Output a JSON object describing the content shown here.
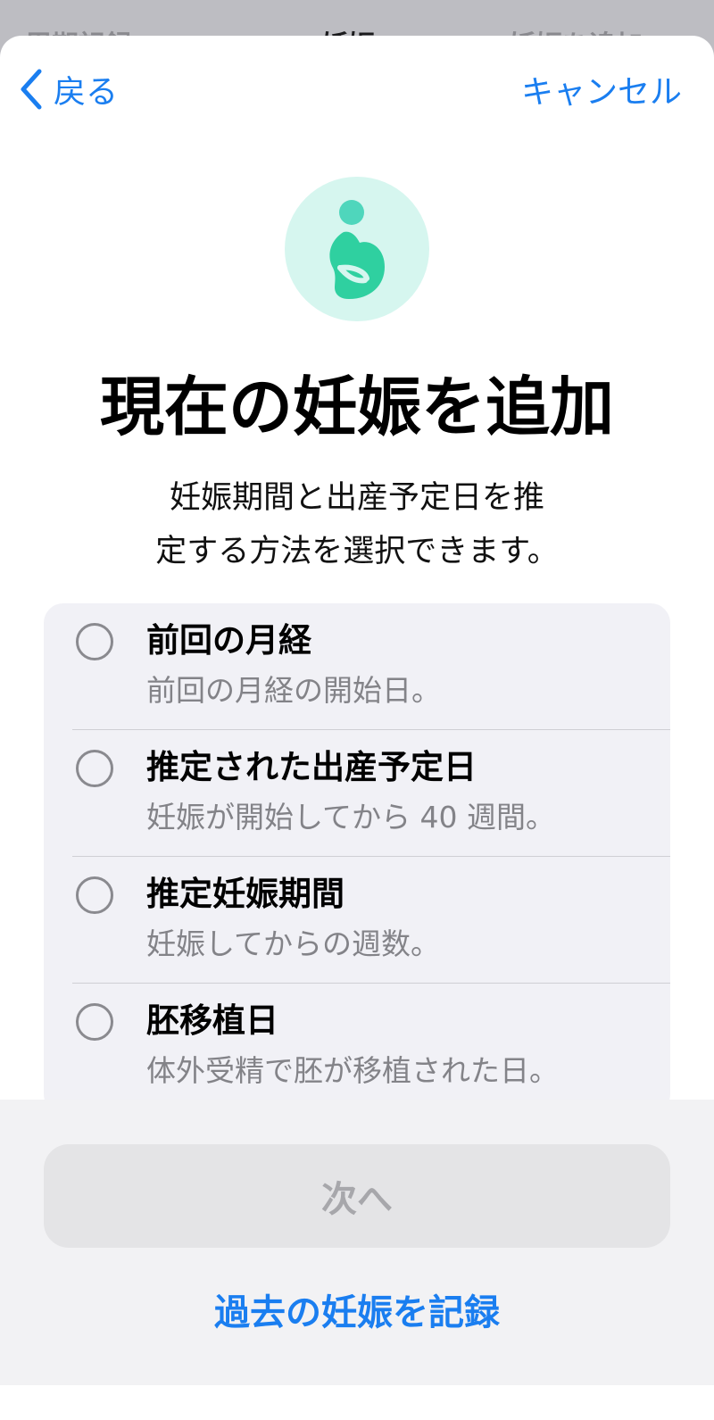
{
  "background_nav": {
    "left": "周期記録",
    "center": "妊娠",
    "right": "妊娠を追加"
  },
  "nav": {
    "back_label": "戻る",
    "cancel_label": "キャンセル"
  },
  "hero_icon": "pregnancy-icon",
  "title": "現在の妊娠を追加",
  "subtitle": {
    "line1": "妊娠期間と出産予定日を推",
    "line2": "定する方法を選択できます。"
  },
  "options": [
    {
      "title": "前回の月経",
      "description": "前回の月経の開始日。",
      "selected": false
    },
    {
      "title": "推定された出産予定日",
      "description": "妊娠が開始してから 40 週間。",
      "selected": false
    },
    {
      "title": "推定妊娠期間",
      "description": "妊娠してからの週数。",
      "selected": false
    },
    {
      "title": "胚移植日",
      "description": "体外受精で胚が移植された日。",
      "selected": false
    }
  ],
  "next_button_label": "次へ",
  "past_pregnancy_link": "過去の妊娠を記録",
  "colors": {
    "accent": "#1a7ef0",
    "icon_green": "#2fd0a0",
    "icon_background": "#d6f6ef"
  }
}
